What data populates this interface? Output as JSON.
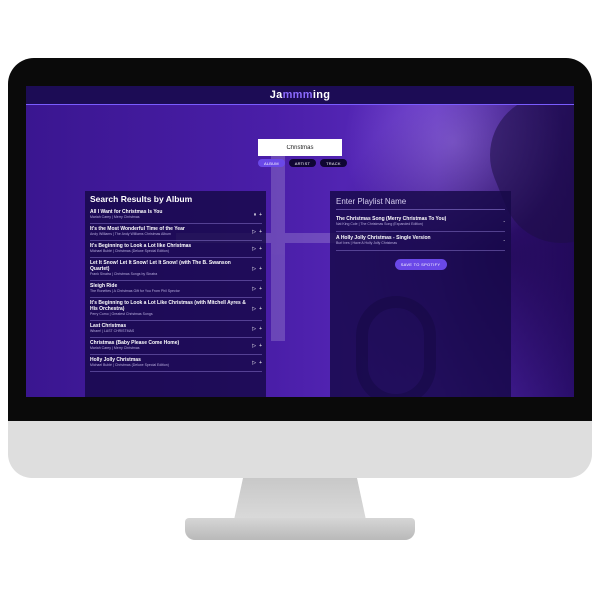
{
  "app": {
    "brand_prefix": "Ja",
    "brand_accent": "mmm",
    "brand_suffix": "ing"
  },
  "search": {
    "value": "Christmas",
    "types": [
      "ALBUM",
      "ARTIST",
      "TRACK"
    ],
    "active_type": "ALBUM"
  },
  "results": {
    "title": "Search Results by Album",
    "items": [
      {
        "name": "All I Want for Christmas Is You",
        "meta": "Mariah Carey | Merry Christmas",
        "action": "⏸",
        "add": "+"
      },
      {
        "name": "It's the Most Wonderful Time of the Year",
        "meta": "Andy Williams | The Andy Williams Christmas Album",
        "action": "▷",
        "add": "+"
      },
      {
        "name": "It's Beginning to Look a Lot like Christmas",
        "meta": "Michael Bublé | Christmas (Deluxe Special Edition)",
        "action": "▷",
        "add": "+"
      },
      {
        "name": "Let It Snow! Let It Snow! Let It Snow! (with The B. Swanson Quartet)",
        "meta": "Frank Sinatra | Christmas Songs by Sinatra",
        "action": "▷",
        "add": "+"
      },
      {
        "name": "Sleigh Ride",
        "meta": "The Ronettes | A Christmas Gift for You From Phil Spector",
        "action": "▷",
        "add": "+"
      },
      {
        "name": "It's Beginning to Look a Lot Like Christmas (with Mitchell Ayres & His Orchestra)",
        "meta": "Perry Como | Greatest Christmas Songs",
        "action": "▷",
        "add": "+"
      },
      {
        "name": "Last Christmas",
        "meta": "Wham! | LAST CHRISTMAS",
        "action": "▷",
        "add": "+"
      },
      {
        "name": "Christmas (Baby Please Come Home)",
        "meta": "Mariah Carey | Merry Christmas",
        "action": "▷",
        "add": "+"
      },
      {
        "name": "Holly Jolly Christmas",
        "meta": "Michael Bublé | Christmas (Deluxe Special Edition)",
        "action": "▷",
        "add": "+"
      }
    ]
  },
  "playlist": {
    "name_placeholder": "Enter Playlist Name",
    "items": [
      {
        "name": "The Christmas Song (Merry Christmas To You)",
        "meta": "Nat King Cole | The Christmas Song (Expanded Edition)",
        "remove": "-"
      },
      {
        "name": "A Holly Jolly Christmas - Single Version",
        "meta": "Burl Ives | Have A Holly Jolly Christmas",
        "remove": "-"
      }
    ],
    "save_label": "SAVE TO SPOTIFY"
  },
  "colors": {
    "accent": "#6a48e8",
    "brand_accent": "#8c6bff",
    "panel": "#160848",
    "background": "#4a1ea8"
  }
}
